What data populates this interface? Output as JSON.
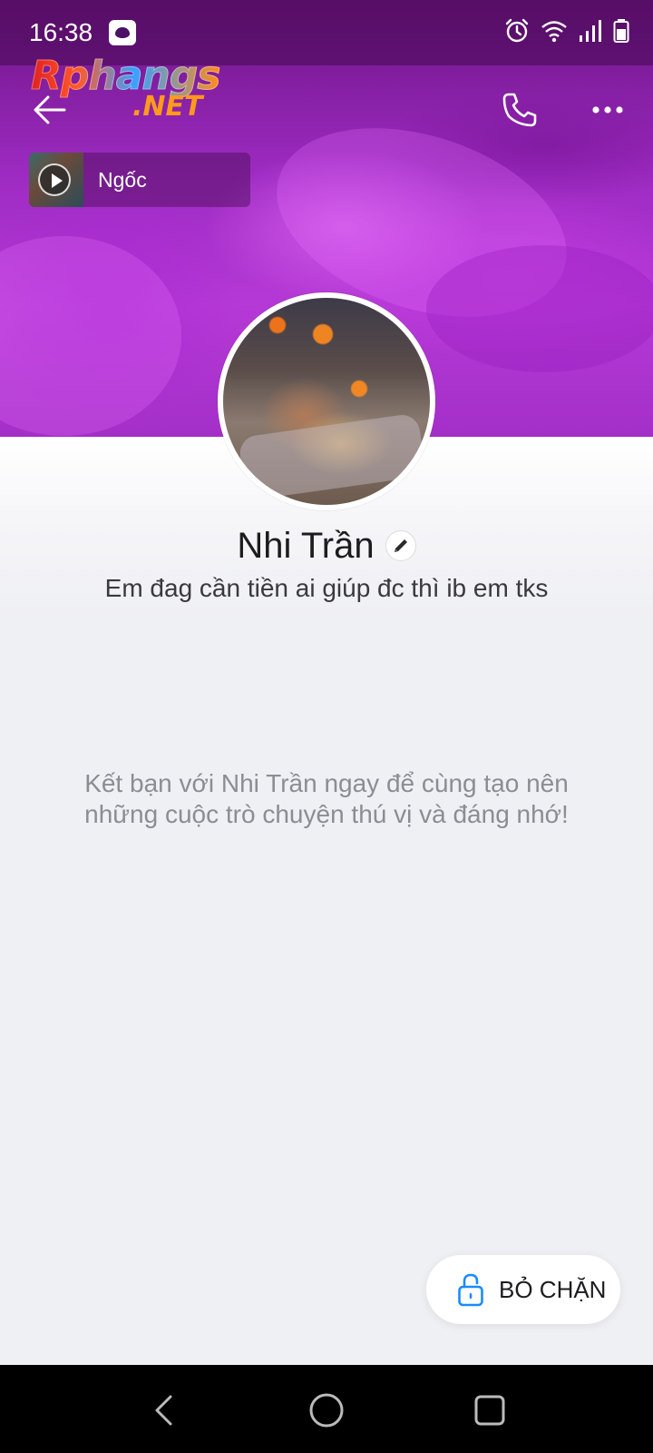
{
  "status_bar": {
    "time": "16:38",
    "icons": [
      "app-notification-icon",
      "alarm-icon",
      "wifi-icon",
      "signal-icon",
      "battery-icon"
    ]
  },
  "watermark": {
    "logo_text": "Rphangs",
    "logo_sub": ".NET"
  },
  "header": {
    "icons": [
      "back-arrow-icon",
      "phone-icon",
      "more-icon"
    ]
  },
  "story": {
    "name": "Ngốc",
    "icon": "play-icon"
  },
  "profile": {
    "name": "Nhi Trần",
    "bio": "Em đag cần tiền ai giúp đc thì ib em tks",
    "edit_icon": "pencil-icon"
  },
  "friend_prompt": "Kết bạn với Nhi Trần ngay để cùng tạo nên những cuộc trò chuyện thú vị và đáng nhớ!",
  "unblock": {
    "label": "BỎ CHẶN",
    "icon": "unlock-icon"
  },
  "colors": {
    "cover_purple": "#a42fc8",
    "page_bg": "#eff0f4",
    "accent_blue": "#1a8cff"
  },
  "nav": {
    "icons": [
      "nav-back-icon",
      "nav-home-icon",
      "nav-recents-icon"
    ]
  }
}
